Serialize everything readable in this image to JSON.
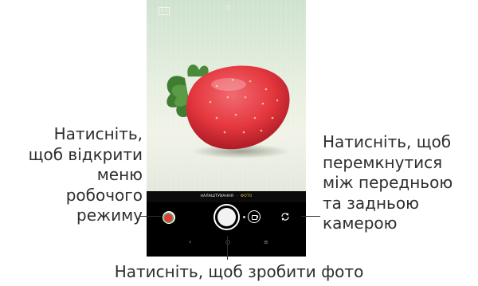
{
  "camera": {
    "ratio_icon": "aspect-ratio-icon",
    "ratio_text": "4:3",
    "timer_icon": "timer-icon",
    "timer_glyph": "⏱",
    "modes": [
      {
        "label": "НАЛАШТУВАННЯ",
        "active": false
      },
      {
        "label": "ФОТО",
        "active": true
      }
    ],
    "mode_separator": "·",
    "controls": {
      "gallery_thumbnail": "gallery-thumbnail",
      "shutter": "shutter-button",
      "video": "video-button",
      "switch_camera": "switch-camera-icon"
    },
    "navbar": {
      "back_glyph": "‹",
      "home_glyph": "○",
      "recent_glyph": "≡"
    },
    "colors": {
      "active_mode": "#f5c63c",
      "strawberry": "#e5373e",
      "leaves": "#4f8a3c"
    }
  },
  "callouts": {
    "left": "Натисніть,\nщоб відкрити\nменю\nробочого\nрежиму",
    "right": "Натисніть, щоб\nперемкнутися\nміж передньою\nта задньою\nкамерою",
    "bottom": "Натисніть, щоб зробити фото"
  }
}
